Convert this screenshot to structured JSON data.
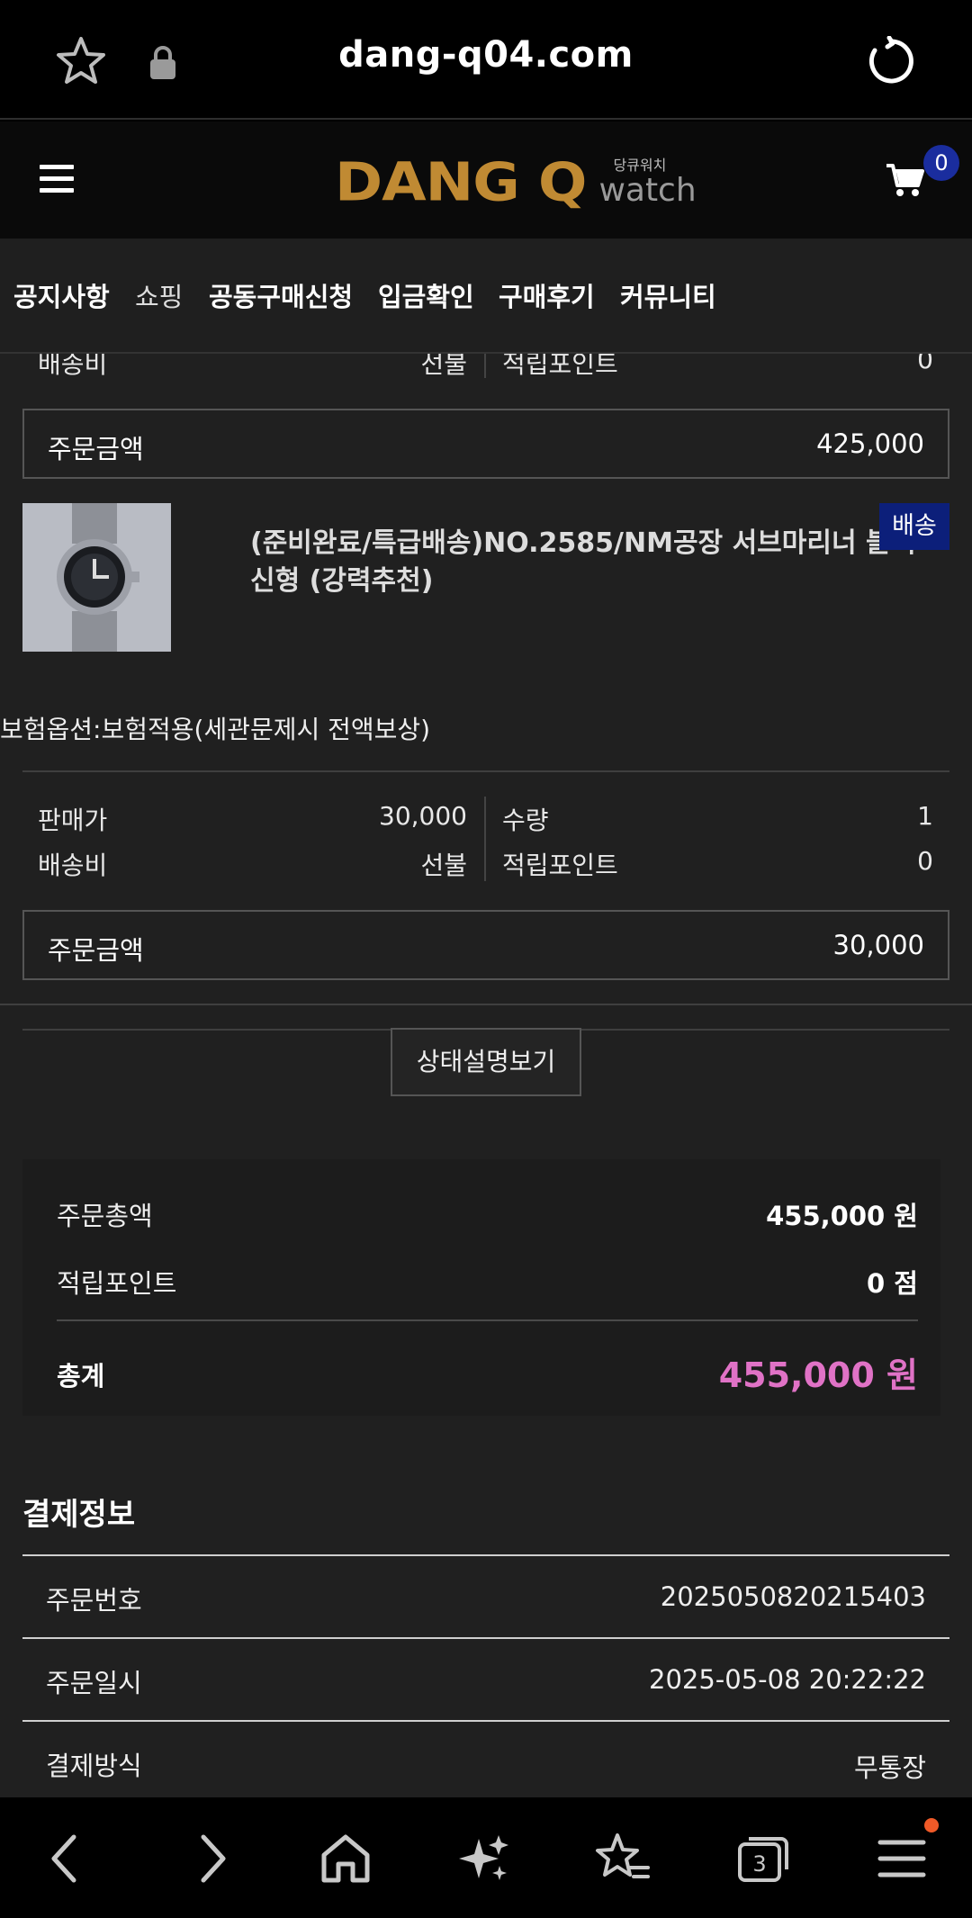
{
  "browser": {
    "url": "dang-q04.com",
    "tab_count": "3"
  },
  "header": {
    "logo_brand": "DANG Q",
    "logo_sub_kr": "당큐워치",
    "logo_sub_en": "watch",
    "cart_count": "0",
    "brand_color": "#c08a33"
  },
  "nav": {
    "items": [
      "공지사항",
      "쇼핑",
      "공동구매신청",
      "입금확인",
      "구매후기",
      "커뮤니티"
    ]
  },
  "item1": {
    "shipping_label": "배송비",
    "shipping_value": "선불",
    "points_label": "적립포인트",
    "points_value": "0",
    "order_amount_label": "주문금액",
    "order_amount_value": "425,000"
  },
  "item2": {
    "name": "(준비완료/특급배송)NO.2585/NM공장 서브마리너 블랙 신형 (강력추천)",
    "badge": "배송",
    "option": "보험옵션:보험적용(세관문제시 전액보상)",
    "price_label": "판매가",
    "price_value": "30,000",
    "qty_label": "수량",
    "qty_value": "1",
    "shipping_label": "배송비",
    "shipping_value": "선불",
    "points_label": "적립포인트",
    "points_value": "0",
    "order_amount_label": "주문금액",
    "order_amount_value": "30,000"
  },
  "status_button": "상태설명보기",
  "summary": {
    "order_total_label": "주문총액",
    "order_total_value": "455,000 원",
    "points_label": "적립포인트",
    "points_value": "0 점",
    "grand_total_label": "총계",
    "grand_total_value": "455,000 원",
    "accent_color": "#e072c6"
  },
  "payment": {
    "title": "결제정보",
    "rows": [
      {
        "label": "주문번호",
        "value": "2025050820215403"
      },
      {
        "label": "주문일시",
        "value": "2025-05-08 20:22:22"
      },
      {
        "label": "결제방식",
        "value": "무통장"
      }
    ]
  },
  "icons": {
    "address_bar": [
      "star-icon",
      "lock-icon",
      "reload-icon"
    ],
    "header": [
      "hamburger-icon",
      "cart-icon"
    ],
    "bottom_bar": [
      "back-icon",
      "forward-icon",
      "home-icon",
      "sparkle-icon",
      "bookmarks-icon",
      "tabs-icon",
      "menu-icon"
    ]
  }
}
